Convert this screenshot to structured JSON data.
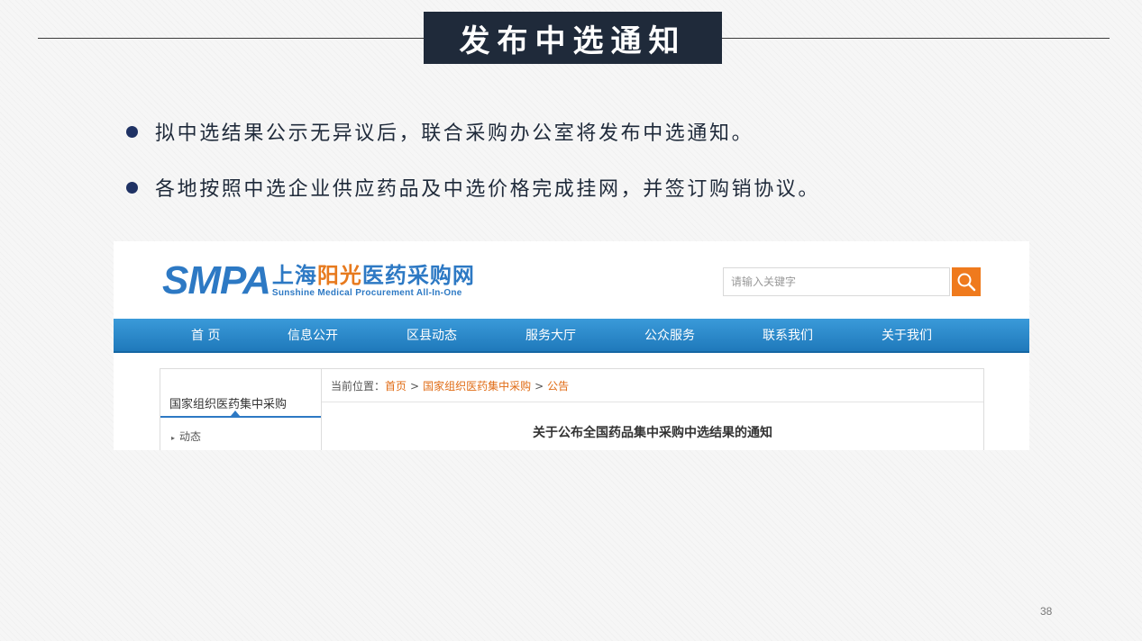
{
  "slide": {
    "title": "发布中选通知",
    "bullets": [
      "拟中选结果公示无异议后，联合采购办公室将发布中选通知。",
      "各地按照中选企业供应药品及中选价格完成挂网，并签订购销协议。"
    ],
    "page_number": "38"
  },
  "website": {
    "logo": {
      "abbr": "SMPA",
      "cn_part1": "上海",
      "cn_part2": "阳光",
      "cn_part3": "医药采购网",
      "en": "Sunshine Medical Procurement All-In-One"
    },
    "search": {
      "placeholder": "请输入关键字",
      "icon": "search-icon"
    },
    "nav": [
      "首 页",
      "信息公开",
      "区县动态",
      "服务大厅",
      "公众服务",
      "联系我们",
      "关于我们"
    ],
    "sidebar": {
      "title": "国家组织医药集中采购",
      "items": [
        "动态"
      ]
    },
    "breadcrumb": {
      "prefix": "当前位置：",
      "items": [
        "首页",
        "国家组织医药集中采购",
        "公告"
      ],
      "separator": ">"
    },
    "article_title": "关于公布全国药品集中采购中选结果的通知"
  },
  "colors": {
    "title_bg": "#1f2a3a",
    "bullet_dot": "#1f3264",
    "brand_blue": "#2d79c4",
    "brand_orange": "#e77a1e",
    "nav_blue": "#1f79bb",
    "link_orange": "#e06b14"
  }
}
